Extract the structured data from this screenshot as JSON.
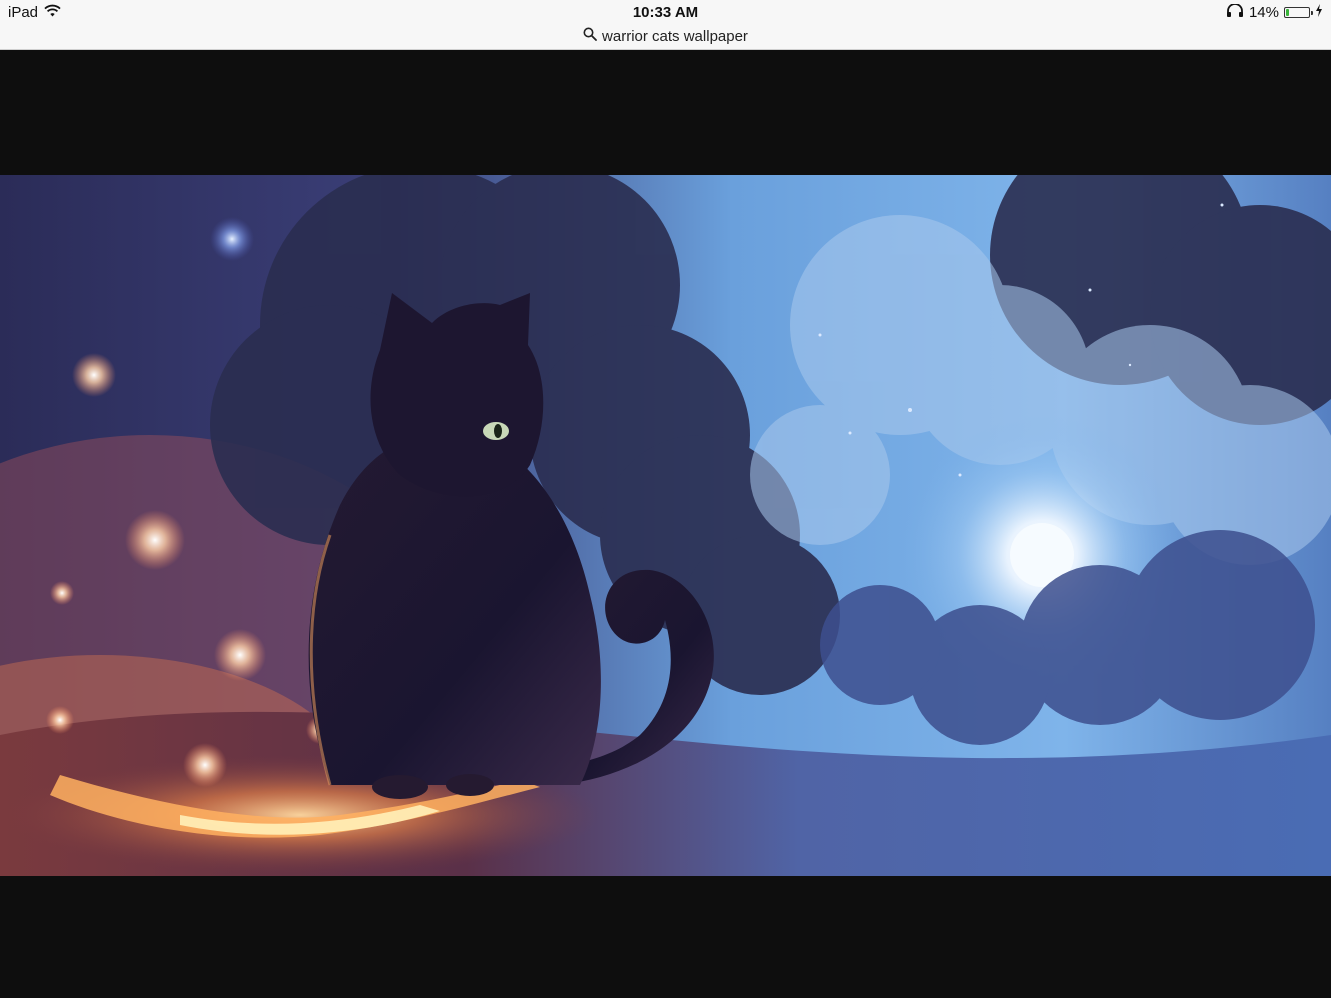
{
  "status_bar": {
    "device": "iPad",
    "time": "10:33 AM",
    "url_text": "warrior cats wallpaper",
    "battery_text": "14%",
    "battery_level": 0.14,
    "icons": [
      "wifi-icon",
      "search-icon",
      "headphones-icon",
      "battery-icon",
      "charging-bolt-icon"
    ]
  },
  "viewer": {
    "background_color": "#0e0e0e"
  },
  "wallpaper": {
    "subject": "black cat on cloud",
    "palette": {
      "sky_light": "#7fb2ea",
      "sky_dark": "#2a2a55",
      "fire": "#ff8a3a",
      "moon": "#f2f8ff",
      "cat": "#1a1530"
    }
  }
}
